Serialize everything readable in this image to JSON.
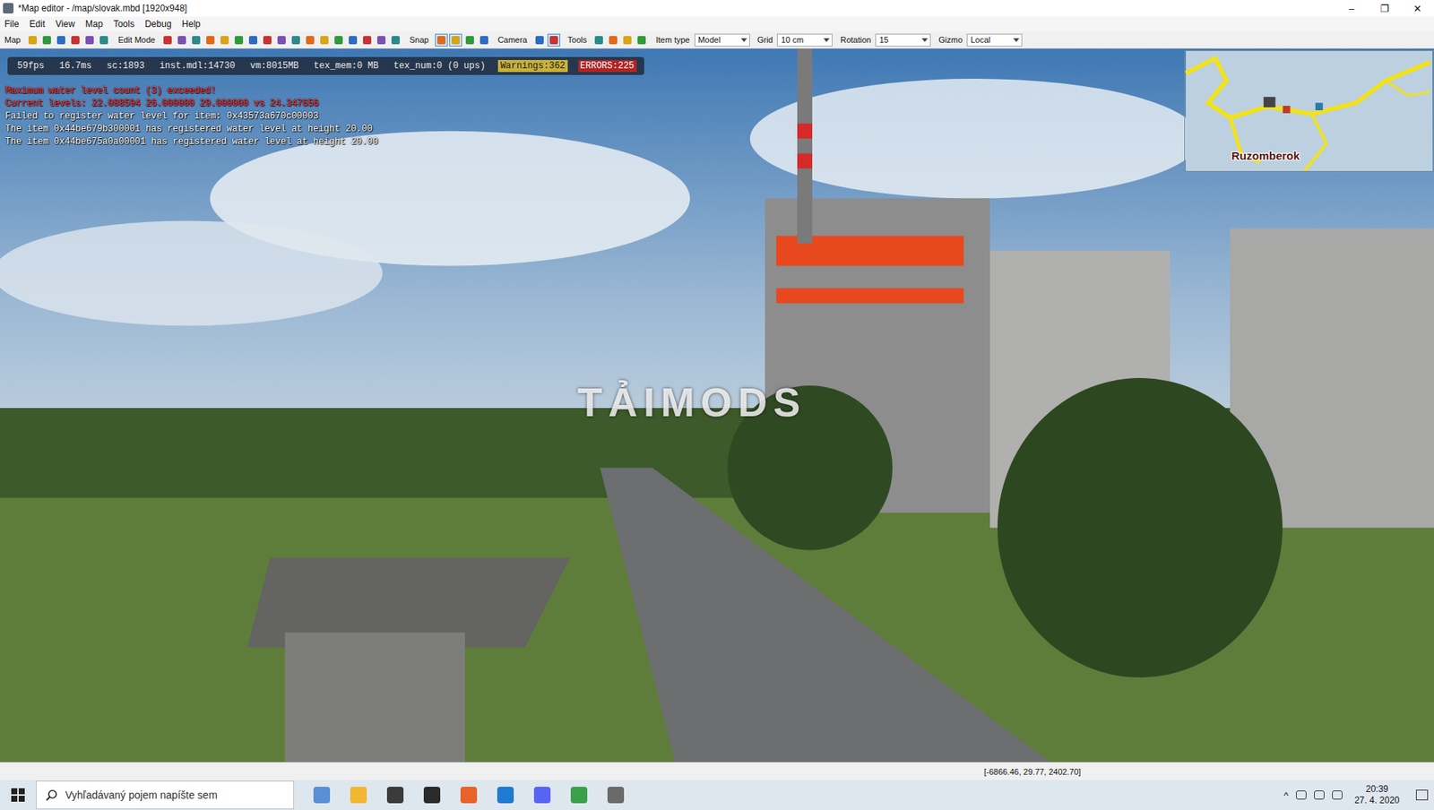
{
  "window": {
    "title": "*Map editor - /map/slovak.mbd [1920x948]",
    "controls": [
      "–",
      "❐",
      "✕"
    ]
  },
  "menu": [
    "File",
    "Edit",
    "View",
    "Map",
    "Tools",
    "Debug",
    "Help"
  ],
  "toolbar": {
    "groups": [
      {
        "label": "Map",
        "tools": [
          {
            "selected": false
          },
          {
            "selected": false
          },
          {
            "selected": false
          },
          {
            "selected": false
          },
          {
            "selected": false
          },
          {
            "selected": false
          }
        ]
      },
      {
        "label": "Edit Mode",
        "tools": [
          {
            "selected": false
          },
          {
            "selected": false
          },
          {
            "selected": false
          },
          {
            "selected": false
          },
          {
            "selected": false
          },
          {
            "selected": false
          },
          {
            "selected": false
          },
          {
            "selected": false
          },
          {
            "selected": false
          },
          {
            "selected": false
          },
          {
            "selected": false
          },
          {
            "selected": false
          },
          {
            "selected": false
          },
          {
            "selected": false
          },
          {
            "selected": false
          },
          {
            "selected": false
          },
          {
            "selected": false
          }
        ]
      },
      {
        "label": "Snap",
        "tools": [
          {
            "selected": true
          },
          {
            "selected": true
          },
          {
            "selected": false
          },
          {
            "selected": false
          }
        ]
      },
      {
        "label": "Camera",
        "tools": [
          {
            "selected": false
          },
          {
            "selected": true
          }
        ]
      },
      {
        "label": "Tools",
        "tools": [
          {
            "selected": false
          },
          {
            "selected": false
          },
          {
            "selected": false
          },
          {
            "selected": false
          }
        ]
      }
    ],
    "dropdowns": [
      {
        "label": "Item type",
        "value": "Model"
      },
      {
        "label": "Grid",
        "value": "10 cm"
      },
      {
        "label": "Rotation",
        "value": "15"
      },
      {
        "label": "Gizmo",
        "value": "Local"
      }
    ]
  },
  "stats": [
    {
      "text": "59fps",
      "kind": "plain"
    },
    {
      "text": "16.7ms",
      "kind": "plain"
    },
    {
      "text": "sc:1893",
      "kind": "plain"
    },
    {
      "text": "inst.mdl:14730",
      "kind": "plain"
    },
    {
      "text": "vm:8015MB",
      "kind": "plain"
    },
    {
      "text": "tex_mem:0 MB",
      "kind": "plain"
    },
    {
      "text": "tex_num:0 (0 ups)",
      "kind": "plain"
    },
    {
      "text": "Warnings:362",
      "kind": "warning"
    },
    {
      "text": "ERRORS:225",
      "kind": "error"
    }
  ],
  "messages": [
    {
      "text": "Maximum water level count (3) exceeded!",
      "color": "#ff3030"
    },
    {
      "text": "Current levels: 22.088594 26.000000 29.000000 vs 24.347656",
      "color": "#ff3030"
    },
    {
      "text": "Failed to register water level for item: 0x43573a670c00003",
      "color": "#ffffff"
    },
    {
      "text": "The item 0x44be679b300001 has registered water level at height 20.00",
      "color": "#ffffff"
    },
    {
      "text": "The item 0x44be675a0a00001 has registered water level at height 20.00",
      "color": "#ffffff"
    }
  ],
  "watermark": "TẢIMODS",
  "minimap": {
    "label": "Ruzomberok"
  },
  "status": {
    "coords": "[-6866.46, 29.77, 2402.70]"
  },
  "taskbar": {
    "search_placeholder": "Vyhľadávaný pojem napíšte sem",
    "tray_arrow": "^",
    "time": "20:39",
    "date": "27. 4. 2020"
  }
}
